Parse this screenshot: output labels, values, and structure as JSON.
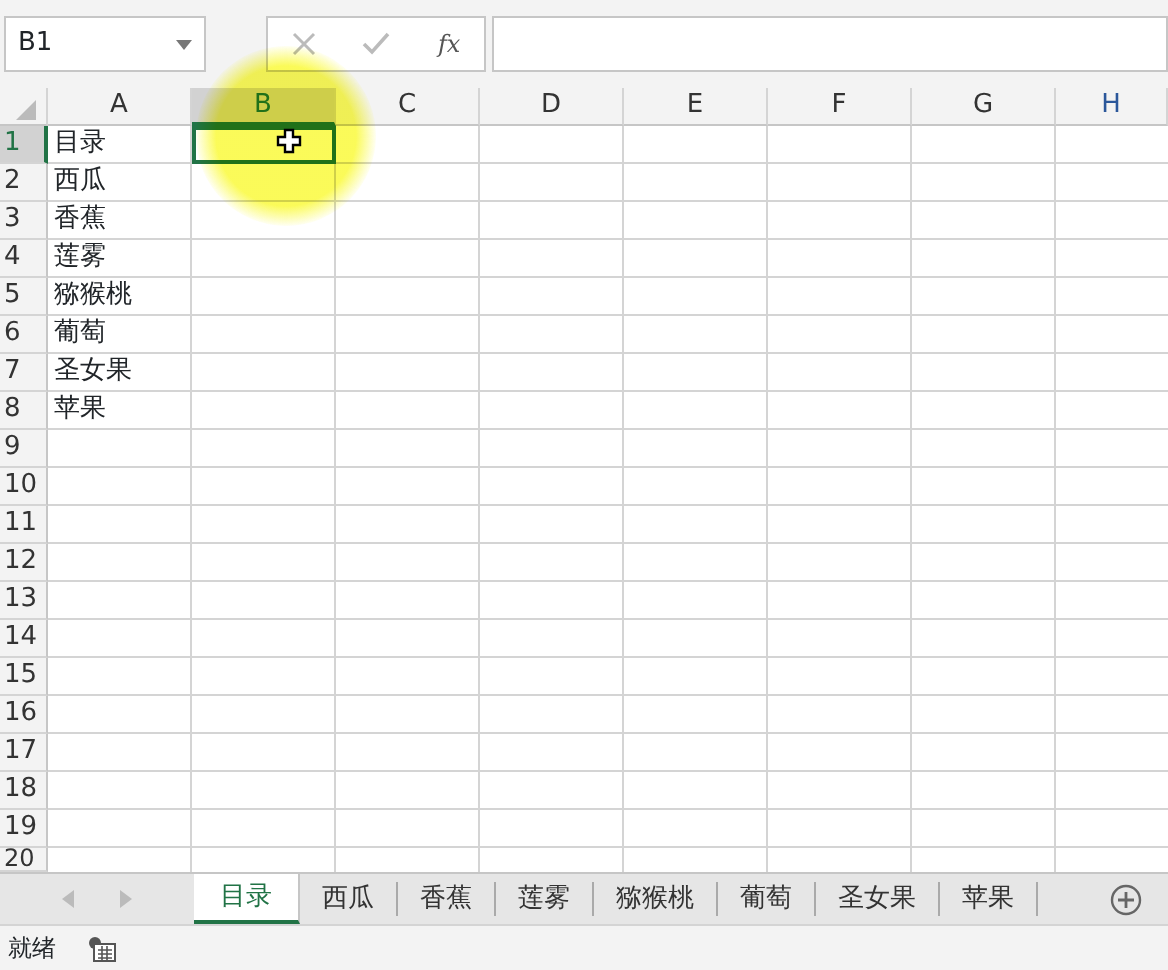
{
  "name_box": {
    "value": "B1"
  },
  "formula_bar": {
    "function_label": "fx"
  },
  "columns": [
    {
      "label": "A",
      "selected": false
    },
    {
      "label": "B",
      "selected": true
    },
    {
      "label": "C",
      "selected": false
    },
    {
      "label": "D",
      "selected": false
    },
    {
      "label": "E",
      "selected": false
    },
    {
      "label": "F",
      "selected": false
    },
    {
      "label": "G",
      "selected": false
    },
    {
      "label": "H",
      "selected": false
    }
  ],
  "rows": [
    {
      "label": "1",
      "selected": true,
      "cells": [
        "目录"
      ]
    },
    {
      "label": "2",
      "selected": false,
      "cells": [
        "西瓜"
      ]
    },
    {
      "label": "3",
      "selected": false,
      "cells": [
        "香蕉"
      ]
    },
    {
      "label": "4",
      "selected": false,
      "cells": [
        "莲雾"
      ]
    },
    {
      "label": "5",
      "selected": false,
      "cells": [
        "猕猴桃"
      ]
    },
    {
      "label": "6",
      "selected": false,
      "cells": [
        "葡萄"
      ]
    },
    {
      "label": "7",
      "selected": false,
      "cells": [
        "圣女果"
      ]
    },
    {
      "label": "8",
      "selected": false,
      "cells": [
        "苹果"
      ]
    },
    {
      "label": "9",
      "selected": false,
      "cells": []
    },
    {
      "label": "10",
      "selected": false,
      "cells": []
    },
    {
      "label": "11",
      "selected": false,
      "cells": []
    },
    {
      "label": "12",
      "selected": false,
      "cells": []
    },
    {
      "label": "13",
      "selected": false,
      "cells": []
    },
    {
      "label": "14",
      "selected": false,
      "cells": []
    },
    {
      "label": "15",
      "selected": false,
      "cells": []
    },
    {
      "label": "16",
      "selected": false,
      "cells": []
    },
    {
      "label": "17",
      "selected": false,
      "cells": []
    },
    {
      "label": "18",
      "selected": false,
      "cells": []
    },
    {
      "label": "19",
      "selected": false,
      "cells": []
    },
    {
      "label": "20",
      "selected": false,
      "cells": []
    }
  ],
  "sheet_tabs": [
    {
      "label": "目录",
      "selected": true
    },
    {
      "label": "西瓜",
      "selected": false
    },
    {
      "label": "香蕉",
      "selected": false
    },
    {
      "label": "莲雾",
      "selected": false
    },
    {
      "label": "猕猴桃",
      "selected": false
    },
    {
      "label": "葡萄",
      "selected": false
    },
    {
      "label": "圣女果",
      "selected": false
    },
    {
      "label": "苹果",
      "selected": false
    }
  ],
  "status_bar": {
    "text": "就绪"
  }
}
